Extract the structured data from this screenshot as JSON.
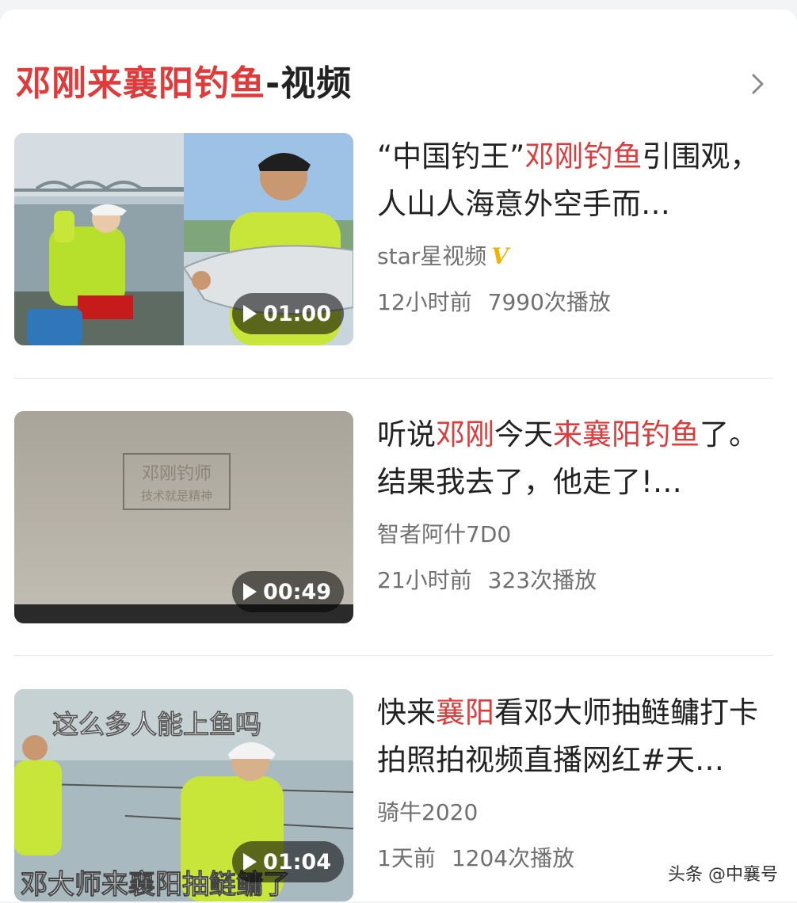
{
  "section": {
    "title_highlight": "邓刚来襄阳钓鱼",
    "title_rest": "-视频"
  },
  "videos": [
    {
      "title_parts": [
        {
          "text": "“中国钓王”",
          "hl": false
        },
        {
          "text": "邓刚钓鱼",
          "hl": true
        },
        {
          "text": "引围观，人山人海意外空手而…",
          "hl": false
        }
      ],
      "author": "star星视频",
      "verified_badge": "V",
      "time": "12小时前",
      "plays": "7990次播放",
      "duration": "01:00"
    },
    {
      "title_parts": [
        {
          "text": "听说",
          "hl": false
        },
        {
          "text": "邓刚",
          "hl": true
        },
        {
          "text": "今天",
          "hl": false
        },
        {
          "text": "来襄阳钓鱼",
          "hl": true
        },
        {
          "text": "了。结果我去了，他走了!…",
          "hl": false
        }
      ],
      "author": "智者阿什7D0",
      "time": "21小时前",
      "plays": "323次播放",
      "duration": "00:49",
      "thumb_stamp_line1": "邓刚钓师",
      "thumb_stamp_line2": "技术就是精神"
    },
    {
      "title_parts": [
        {
          "text": "快来",
          "hl": false
        },
        {
          "text": "襄阳",
          "hl": true
        },
        {
          "text": "看邓大师抽鲢鳙打卡拍照拍视频直播网红#天…",
          "hl": false
        }
      ],
      "author": "骑牛2020",
      "time": "1天前",
      "plays": "1204次播放",
      "duration": "01:04",
      "thumb_caption_top": "这么多人能上鱼吗",
      "thumb_caption_bottom": "邓大师来襄阳抽鲢鳙了"
    }
  ],
  "watermark": "头条 @中襄号",
  "colors": {
    "accent": "#e03a3a",
    "badge": "#f0b400"
  }
}
